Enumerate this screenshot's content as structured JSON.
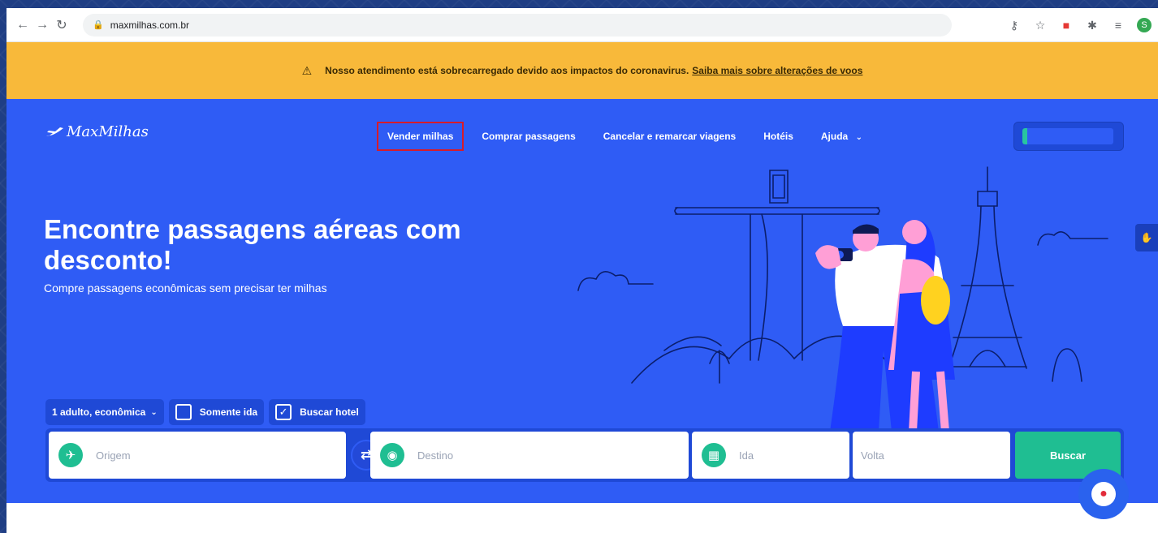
{
  "browser": {
    "url": "maxmilhas.com.br",
    "profile_initial": "S"
  },
  "notice": {
    "text": "Nosso atendimento está sobrecarregado devido aos impactos do coronavirus.",
    "link": "Saiba mais sobre alterações de voos"
  },
  "header": {
    "logo": "MaxMilhas",
    "nav": {
      "vender": "Vender milhas",
      "comprar": "Comprar passagens",
      "cancelar": "Cancelar e remarcar viagens",
      "hoteis": "Hotéis",
      "ajuda": "Ajuda"
    }
  },
  "hero": {
    "title": "Encontre passagens aéreas com desconto!",
    "subtitle": "Compre passagens econômicas sem precisar ter milhas"
  },
  "search": {
    "passengers": "1 adulto, econômica",
    "one_way": "Somente ida",
    "hotel": "Buscar hotel",
    "hotel_checked": true,
    "origin_placeholder": "Origem",
    "destination_placeholder": "Destino",
    "departure_placeholder": "Ida",
    "return_placeholder": "Volta",
    "submit": "Buscar"
  },
  "colors": {
    "banner": "#f8b93a",
    "hero": "#2f5cf5",
    "accent": "#1fbe92",
    "highlight_border": "#d81b2a"
  }
}
